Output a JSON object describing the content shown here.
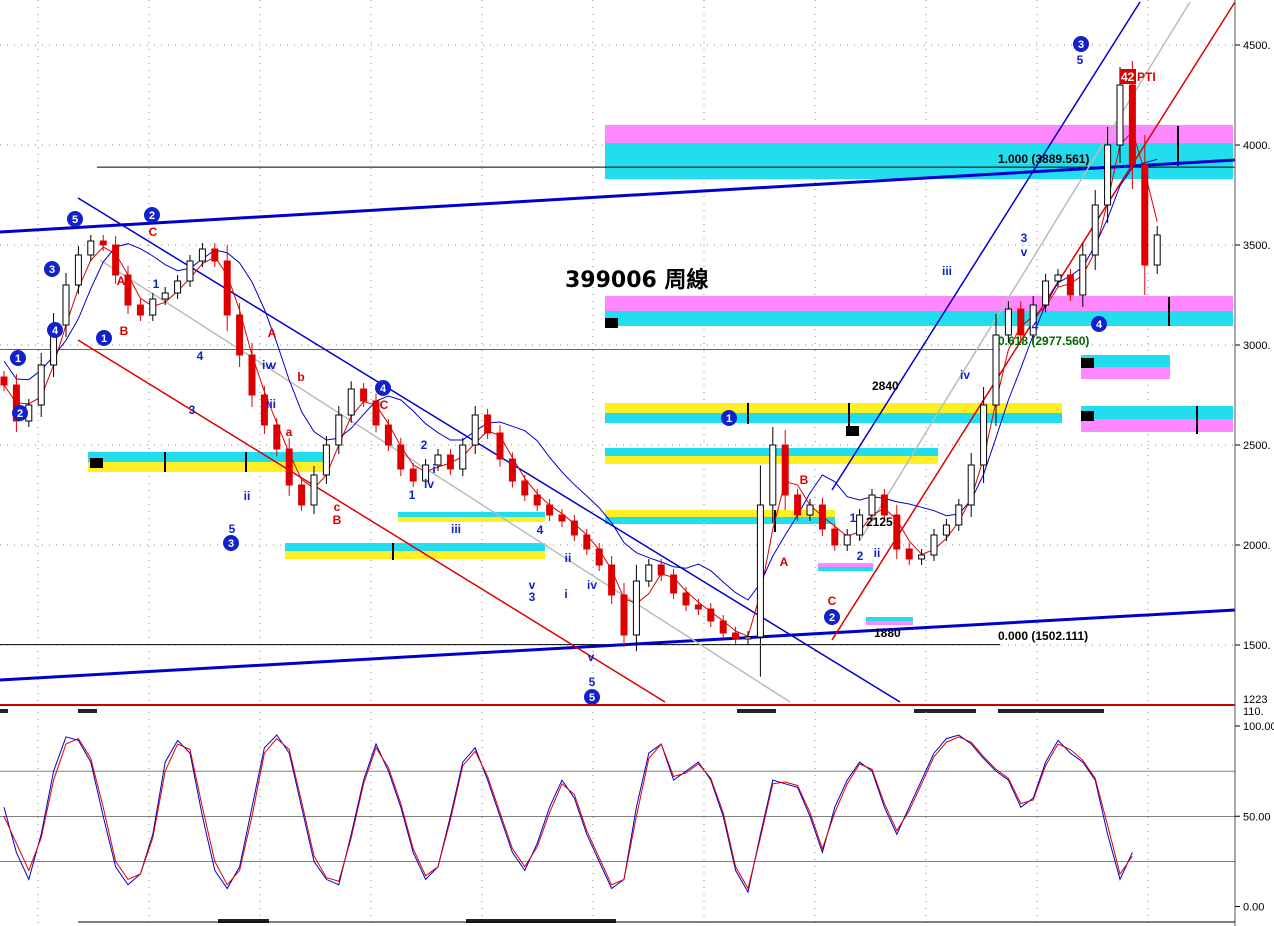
{
  "chart_data": [
    {
      "type": "candlestick",
      "title": "399006 周線",
      "ylim": [
        1223,
        4700
      ],
      "yticks": [
        "4500.",
        "4000.",
        "3500.",
        "3000.",
        "2500.",
        "2000.",
        "1500."
      ],
      "ytick_values": [
        4500,
        4000,
        3500,
        3000,
        2500,
        2000,
        1500
      ],
      "current_price_label": "1223",
      "grid": true,
      "fib_labels": [
        "1.000 (3889.561)",
        "0.618 (2977.560)",
        "0.000 (1502.111)"
      ],
      "fib_values": [
        3889.561,
        2977.56,
        1502.111
      ],
      "price_labels": [
        "2840",
        "2125",
        "1880"
      ],
      "badge": "42",
      "badge_text": "PTI",
      "colors": {
        "up": "#000000",
        "down": "#dd0000",
        "ma_fast": "#dd0000",
        "ma_slow": "#0000cc",
        "channel_blue": "#0000cc",
        "channel_red": "#dd0000",
        "mid_line": "#bbbbbb"
      },
      "circle_labels": [
        "5",
        "2",
        "1",
        "2",
        "3",
        "4",
        "1",
        "3",
        "4",
        "5",
        "1",
        "2",
        "3",
        "4"
      ],
      "wave_labels": [
        "C",
        "A",
        "B",
        "A",
        "1",
        "4",
        "3",
        "ii",
        "iv",
        "iii",
        "v",
        "5",
        "b",
        "a",
        "c",
        "B",
        "C",
        "2",
        "i",
        "1",
        "iv",
        "iii",
        "4",
        "v",
        "3",
        "ii",
        "i",
        "iv",
        "v",
        "5",
        "B",
        "A",
        "C",
        "1",
        "2",
        "ii",
        "iii",
        "iv",
        "3",
        "v",
        "4",
        "5"
      ],
      "close_series": [
        2800,
        2620,
        2700,
        2900,
        3100,
        3300,
        3450,
        3520,
        3500,
        3350,
        3200,
        3150,
        3230,
        3260,
        3320,
        3420,
        3480,
        3420,
        3150,
        2950,
        2750,
        2600,
        2480,
        2300,
        2200,
        2350,
        2500,
        2650,
        2780,
        2720,
        2600,
        2500,
        2380,
        2320,
        2400,
        2450,
        2380,
        2500,
        2650,
        2560,
        2430,
        2320,
        2250,
        2200,
        2150,
        2120,
        2050,
        1980,
        1900,
        1750,
        1550,
        1820,
        1900,
        1850,
        1760,
        1700,
        1680,
        1620,
        1560,
        1530,
        1540,
        2200,
        2500,
        2250,
        2150,
        2200,
        2080,
        2000,
        2050,
        2150,
        2250,
        2150,
        1980,
        1930,
        1950,
        2050,
        2100,
        2200,
        2400,
        2700,
        3050,
        3180,
        3050,
        3200,
        3320,
        3350,
        3250,
        3450,
        3700,
        4000,
        4300,
        3900,
        3400,
        3550
      ]
    },
    {
      "type": "line",
      "title": "",
      "ylim": [
        -5,
        112
      ],
      "yticks": [
        "100.00",
        "50.00",
        "0.00"
      ],
      "ytick_values": [
        100,
        50,
        0
      ],
      "top_label": "110.",
      "hlines": [
        75,
        50,
        25
      ],
      "series": [
        {
          "values": [
            55,
            30,
            15,
            40,
            75,
            94,
            92,
            80,
            50,
            22,
            12,
            18,
            40,
            80,
            92,
            85,
            50,
            20,
            10,
            22,
            55,
            88,
            95,
            85,
            55,
            25,
            15,
            12,
            40,
            70,
            90,
            75,
            55,
            30,
            15,
            22,
            50,
            80,
            88,
            70,
            50,
            30,
            20,
            35,
            55,
            70,
            60,
            40,
            25,
            10,
            15,
            55,
            85,
            90,
            70,
            75,
            80,
            70,
            50,
            20,
            8,
            40,
            70,
            68,
            66,
            50,
            30,
            55,
            70,
            80,
            75,
            55,
            40,
            55,
            70,
            85,
            93,
            95,
            90,
            82,
            75,
            70,
            55,
            60,
            80,
            92,
            85,
            80,
            70,
            40,
            15,
            30
          ],
          "color": "#0000cc"
        },
        {
          "values": [
            50,
            35,
            20,
            38,
            70,
            90,
            93,
            82,
            55,
            25,
            15,
            18,
            38,
            75,
            90,
            87,
            55,
            25,
            12,
            20,
            50,
            85,
            93,
            87,
            58,
            28,
            16,
            14,
            38,
            68,
            88,
            77,
            57,
            32,
            17,
            22,
            48,
            78,
            86,
            72,
            52,
            32,
            22,
            33,
            52,
            68,
            62,
            42,
            27,
            12,
            15,
            50,
            82,
            90,
            72,
            74,
            79,
            71,
            52,
            22,
            10,
            38,
            68,
            69,
            67,
            52,
            32,
            52,
            68,
            79,
            76,
            57,
            42,
            53,
            68,
            83,
            91,
            94,
            91,
            83,
            76,
            71,
            57,
            59,
            78,
            90,
            87,
            81,
            71,
            45,
            18,
            28
          ],
          "color": "#dd0000"
        }
      ]
    }
  ]
}
